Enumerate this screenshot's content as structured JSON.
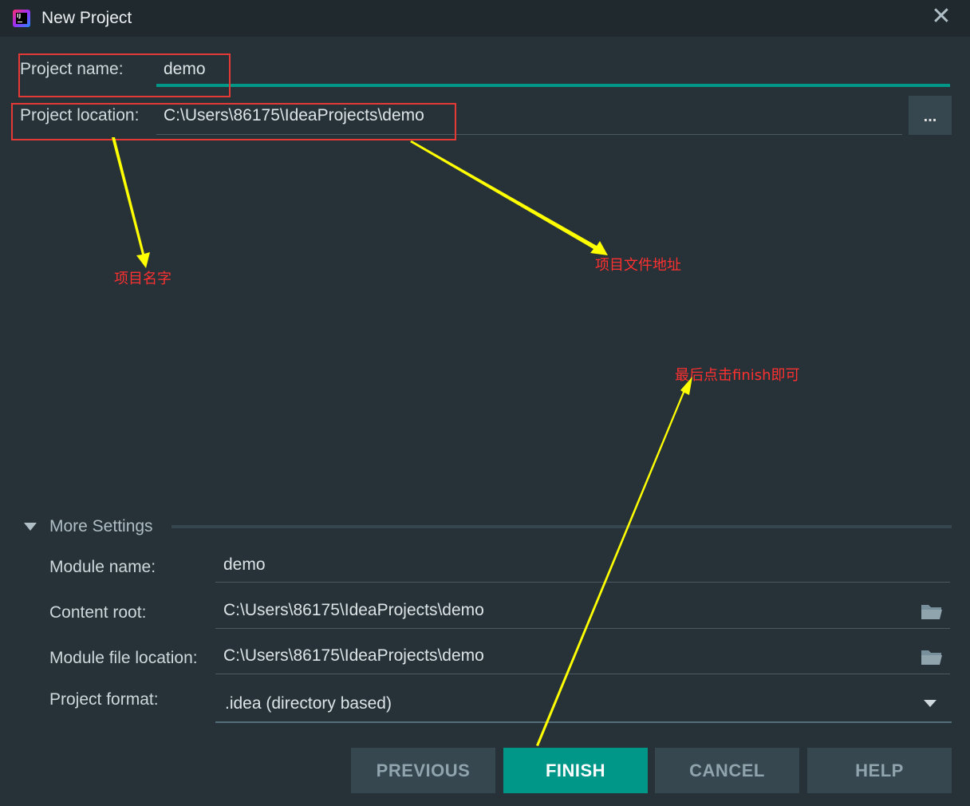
{
  "window": {
    "title": "New Project",
    "close_glyph": "✕",
    "icon": "intellij-idea-icon"
  },
  "form": {
    "project_name_label": "Project name:",
    "project_name_value": "demo",
    "project_location_label": "Project location:",
    "project_location_value": "C:\\Users\\86175\\IdeaProjects\\demo",
    "browse_label": "..."
  },
  "more_settings": {
    "label": "More Settings",
    "module_name_label": "Module name:",
    "module_name_value": "demo",
    "content_root_label": "Content root:",
    "content_root_value": "C:\\Users\\86175\\IdeaProjects\\demo",
    "module_file_location_label": "Module file location:",
    "module_file_location_value": "C:\\Users\\86175\\IdeaProjects\\demo",
    "project_format_label": "Project format:",
    "project_format_value": ".idea (directory based)"
  },
  "buttons": {
    "previous": "PREVIOUS",
    "finish": "FINISH",
    "cancel": "CANCEL",
    "help": "HELP"
  },
  "annotations": {
    "project_name_note": "项目名字",
    "project_location_note": "项目文件地址",
    "finish_note": "最后点击finish即可"
  },
  "colors": {
    "background": "#263238",
    "accent": "#009688",
    "annotation_box": "#e53935",
    "annotation_arrow": "#ffff00",
    "annotation_text": "#ff3030"
  }
}
